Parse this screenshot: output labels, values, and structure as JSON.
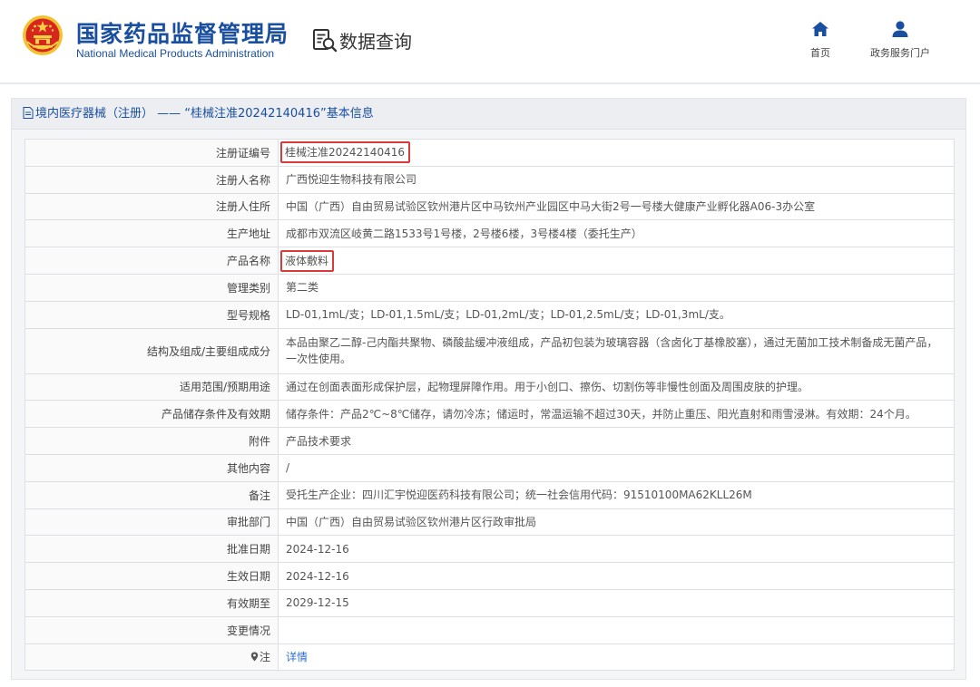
{
  "header": {
    "org_name_cn": "国家药品监督管理局",
    "org_name_en": "National Medical Products Administration",
    "section_title": "数据查询",
    "nav": [
      {
        "label": "首页",
        "icon": "home-icon"
      },
      {
        "label": "政务服务门户",
        "icon": "user-icon"
      }
    ]
  },
  "panel": {
    "title": "境内医疗器械（注册） —— “桂械注准20242140416”基本信息"
  },
  "colors": {
    "brand_blue": "#1a4fa0",
    "highlight_red": "#d93a3a",
    "link_blue": "#2f6fd1"
  },
  "records": [
    {
      "label": "注册证编号",
      "value": "桂械注准20242140416"
    },
    {
      "label": "注册人名称",
      "value": "广西悦迎生物科技有限公司"
    },
    {
      "label": "注册人住所",
      "value": "中国（广西）自由贸易试验区钦州港片区中马钦州产业园区中马大街2号一号楼大健康产业孵化器A06-3办公室"
    },
    {
      "label": "生产地址",
      "value": "成都市双流区岐黄二路1533号1号楼，2号楼6楼，3号楼4楼（委托生产）"
    },
    {
      "label": "产品名称",
      "value": "液体敷料"
    },
    {
      "label": "管理类别",
      "value": "第二类"
    },
    {
      "label": "型号规格",
      "value": "LD-01,1mL/支；LD-01,1.5mL/支；LD-01,2mL/支；LD-01,2.5mL/支；LD-01,3mL/支。"
    },
    {
      "label": "结构及组成/主要组成成分",
      "value": "本品由聚乙二醇-己内酯共聚物、磷酸盐缓冲液组成，产品初包装为玻璃容器（含卤化丁基橡胶塞），通过无菌加工技术制备成无菌产品，一次性使用。"
    },
    {
      "label": "适用范围/预期用途",
      "value": "通过在创面表面形成保护层，起物理屏障作用。用于小创口、擦伤、切割伤等非慢性创面及周围皮肤的护理。"
    },
    {
      "label": "产品储存条件及有效期",
      "value": "储存条件：产品2℃~8℃储存，请勿冷冻；储运时，常温运输不超过30天，并防止重压、阳光直射和雨雪浸淋。有效期：24个月。"
    },
    {
      "label": "附件",
      "value": "产品技术要求"
    },
    {
      "label": "其他内容",
      "value": "/"
    },
    {
      "label": "备注",
      "value": "受托生产企业：四川汇宇悦迎医药科技有限公司；统一社会信用代码：91510100MA62KLL26M"
    },
    {
      "label": "审批部门",
      "value": "中国（广西）自由贸易试验区钦州港片区行政审批局"
    },
    {
      "label": "批准日期",
      "value": "2024-12-16"
    },
    {
      "label": "生效日期",
      "value": "2024-12-16"
    },
    {
      "label": "有效期至",
      "value": "2029-12-15"
    },
    {
      "label": "变更情况",
      "value": ""
    },
    {
      "label": "注",
      "value": "详情"
    }
  ]
}
